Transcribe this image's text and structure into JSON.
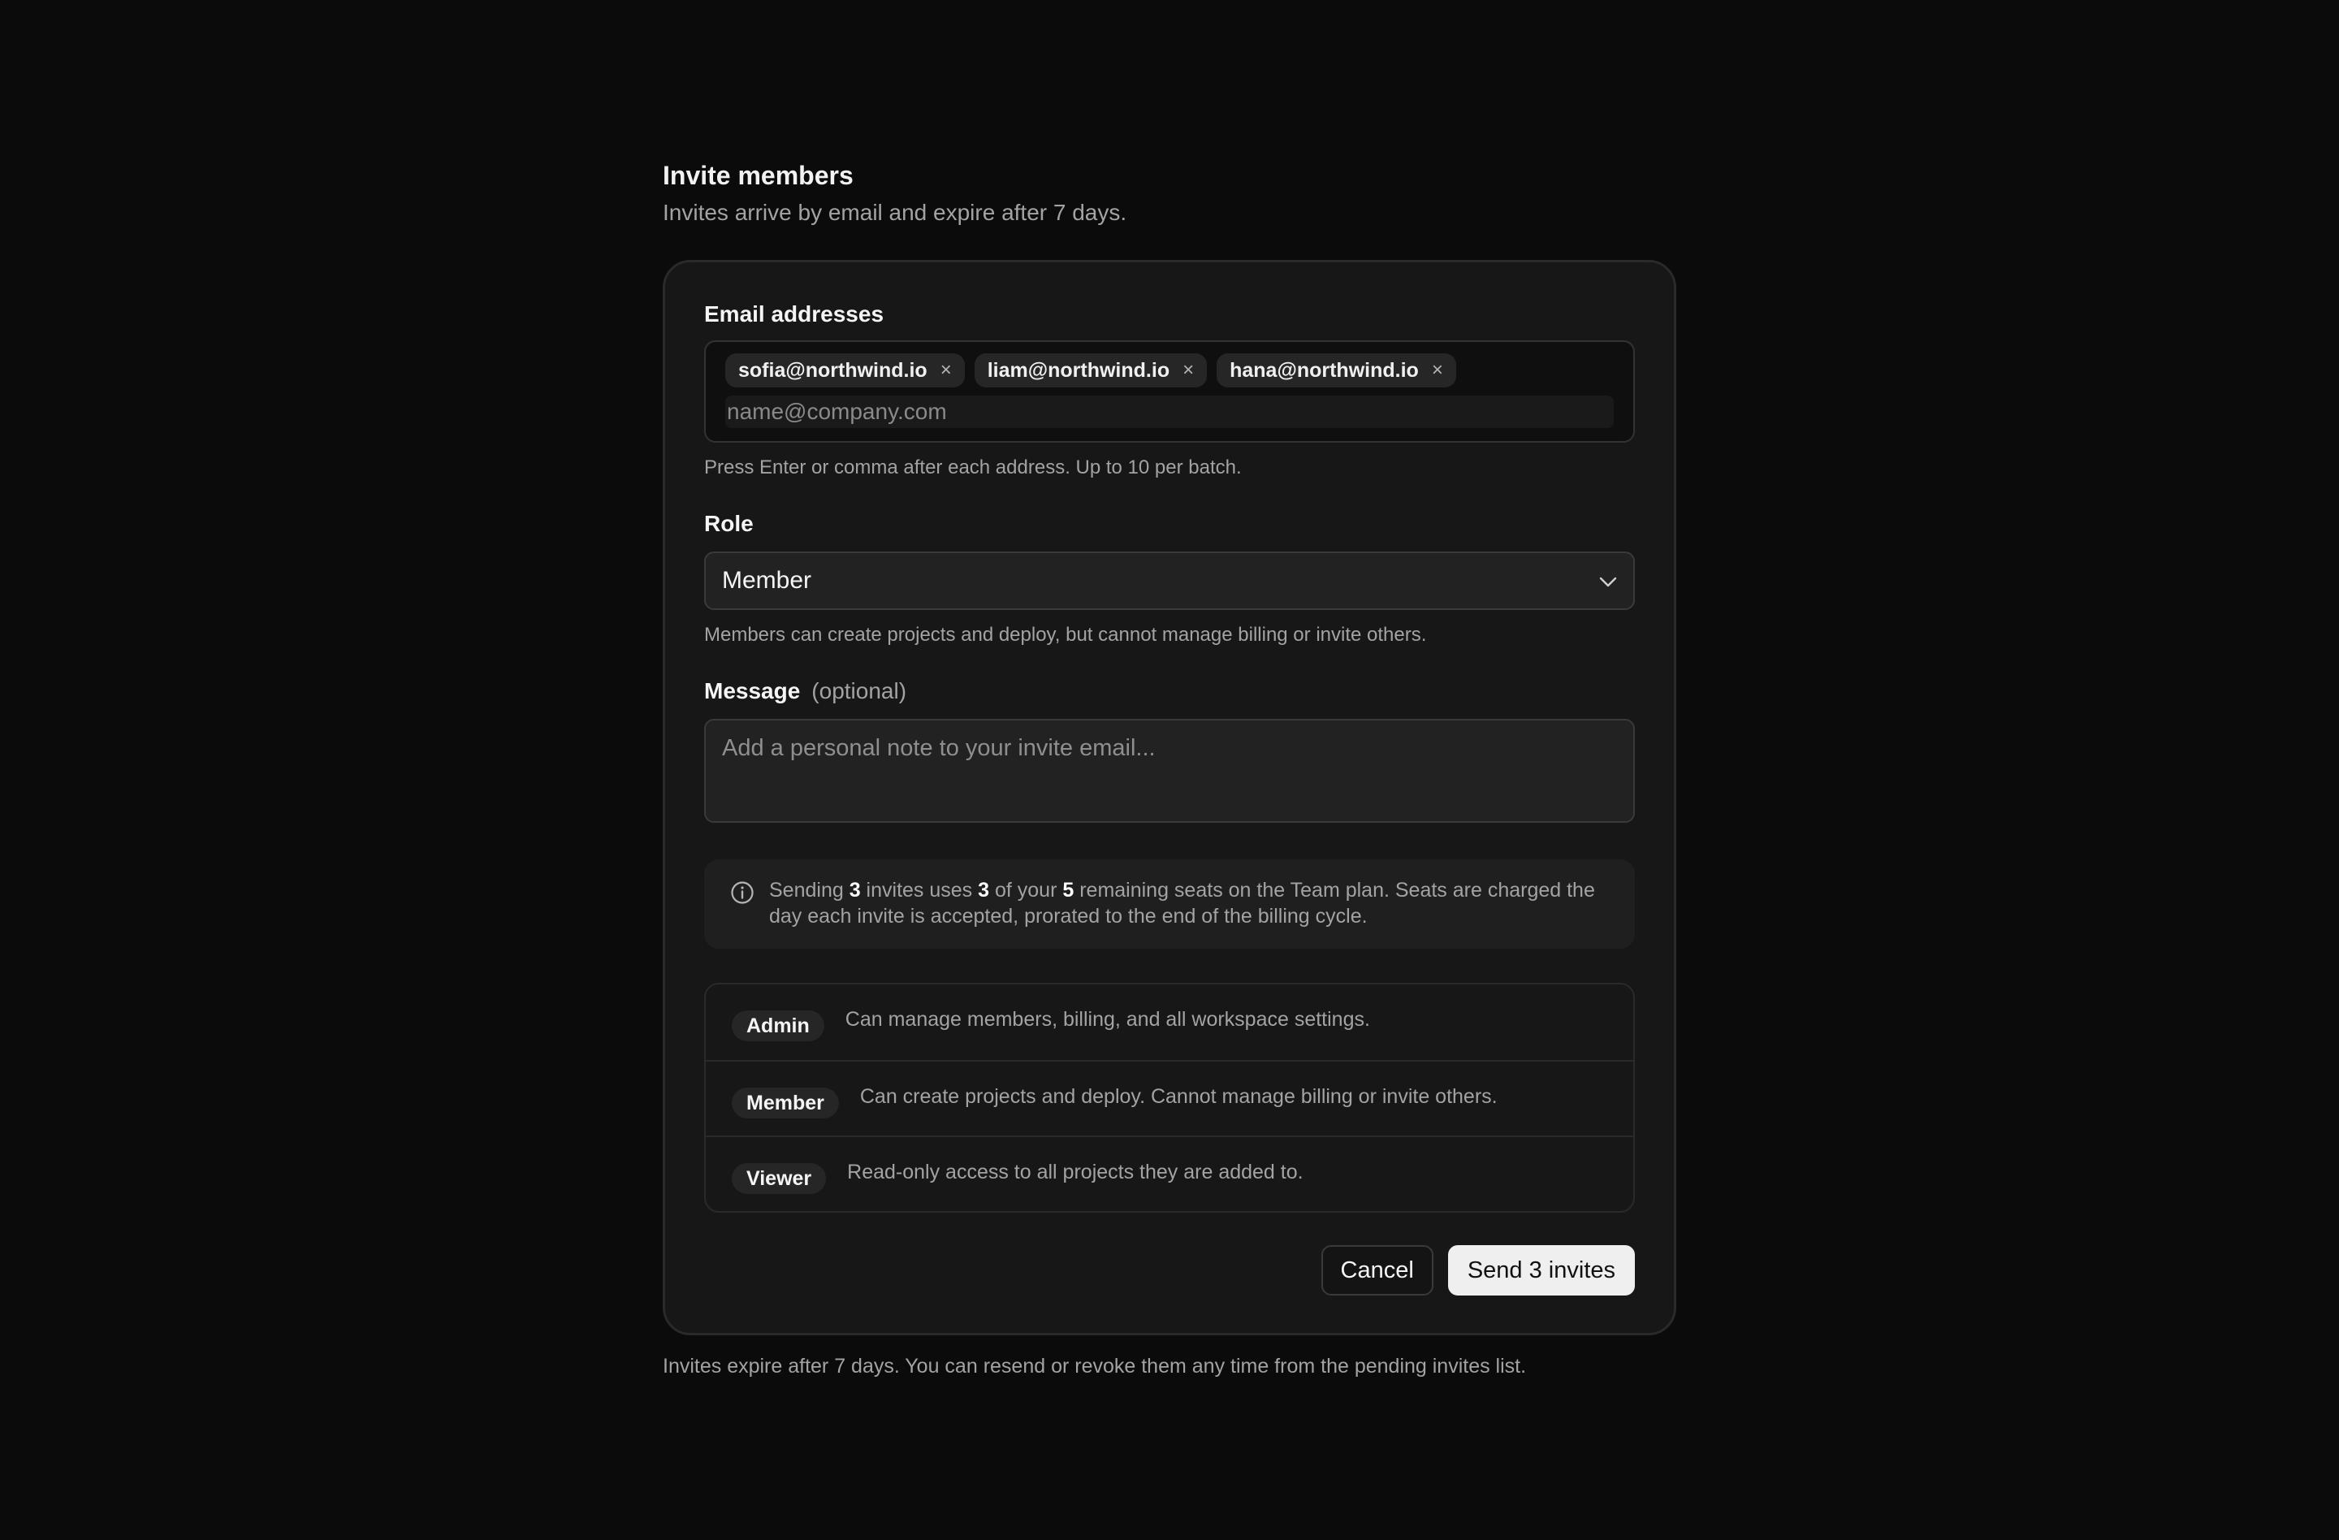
{
  "header": {
    "title": "Invite members",
    "subtitle": "Invites arrive by email and expire after 7 days."
  },
  "email": {
    "label": "Email addresses",
    "chips": [
      "sofia@northwind.io",
      "liam@northwind.io",
      "hana@northwind.io"
    ],
    "remove_glyph": "×",
    "placeholder": "name@company.com",
    "value": "",
    "hint": "Press Enter or comma after each address. Up to 10 per batch."
  },
  "role": {
    "label": "Role",
    "selected": "Member",
    "description": "Members can create projects and deploy, but cannot manage billing or invite others."
  },
  "message": {
    "label": "Message",
    "optional": "(optional)",
    "placeholder": "Add a personal note to your invite email...",
    "value": ""
  },
  "notice": {
    "icon": "info-icon",
    "p1": "Sending ",
    "count": "3",
    "p2": " invites uses ",
    "used": "3",
    "p3": " of your ",
    "remaining": "5",
    "p4": " remaining seats on the Team plan. Seats are charged the day each invite is accepted, prorated to the end of the billing cycle."
  },
  "roles": [
    {
      "name": "Admin",
      "desc": "Can manage members, billing, and all workspace settings."
    },
    {
      "name": "Member",
      "desc": "Can create projects and deploy. Cannot manage billing or invite others."
    },
    {
      "name": "Viewer",
      "desc": "Read-only access to all projects they are added to."
    }
  ],
  "actions": {
    "cancel": "Cancel",
    "send": "Send 3 invites"
  },
  "footer": "Invites expire after 7 days. You can resend or revoke them any time from the pending invites list."
}
